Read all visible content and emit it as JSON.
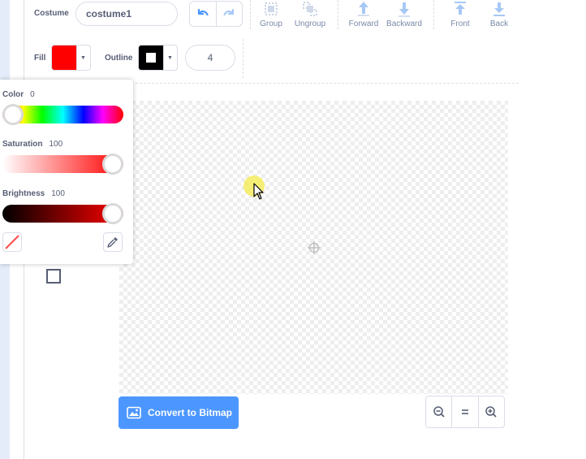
{
  "costume": {
    "label": "Costume",
    "name": "costume1"
  },
  "toolbar": {
    "group": "Group",
    "ungroup": "Ungroup",
    "forward": "Forward",
    "backward": "Backward",
    "front": "Front",
    "back": "Back"
  },
  "fill": {
    "label": "Fill",
    "color": "#ff0000"
  },
  "outline": {
    "label": "Outline",
    "color": "#000000",
    "width": "4"
  },
  "color_picker": {
    "color_label": "Color",
    "color_value": "0",
    "color_level": 0,
    "saturation_label": "Saturation",
    "saturation_value": "100",
    "saturation_level": 100,
    "brightness_label": "Brightness",
    "brightness_value": "100",
    "brightness_level": 100
  },
  "convert_button": "Convert to Bitmap",
  "colors": {
    "accent": "#4c97ff",
    "text": "#575e75",
    "border": "#d9dde6"
  },
  "icons": [
    "undo-icon",
    "redo-icon",
    "group-icon",
    "ungroup-icon",
    "forward-icon",
    "backward-icon",
    "front-icon",
    "back-icon",
    "no-fill-icon",
    "eyedropper-icon",
    "rectangle-tool-icon",
    "bitmap-icon",
    "zoom-out-icon",
    "zoom-reset-icon",
    "zoom-in-icon",
    "crosshair-icon"
  ]
}
